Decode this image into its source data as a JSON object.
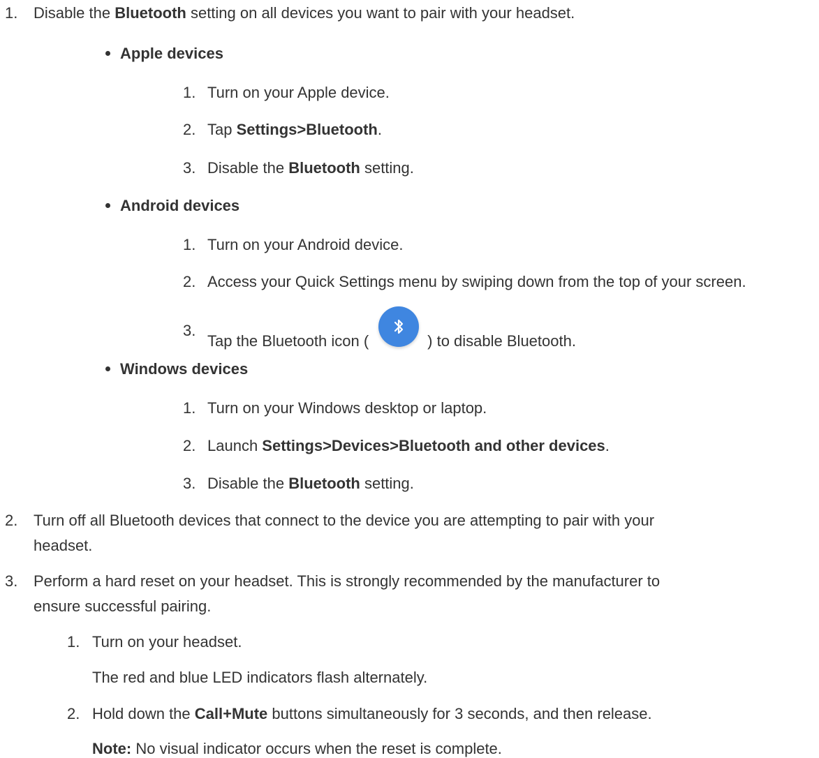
{
  "steps": {
    "s1": {
      "num": "1.",
      "pre": "Disable the ",
      "bold": "Bluetooth",
      "post": " setting on all devices you want to pair with your headset.",
      "groups": {
        "apple": {
          "title": "Apple devices",
          "items": [
            {
              "num": "1.",
              "pre": "Turn on your Apple device.",
              "bold": "",
              "post": ""
            },
            {
              "num": "2.",
              "pre": "Tap ",
              "bold": "Settings>Bluetooth",
              "post": "."
            },
            {
              "num": "3.",
              "pre": "Disable the ",
              "bold": "Bluetooth",
              "post": " setting."
            }
          ]
        },
        "android": {
          "title": "Android devices",
          "items": [
            {
              "num": "1.",
              "pre": "Turn on your Android device.",
              "bold": "",
              "post": ""
            },
            {
              "num": "2.",
              "pre": "Access your Quick Settings menu by swiping down from the top of your screen.",
              "bold": "",
              "post": ""
            },
            {
              "num": "3.",
              "pre": "Tap the Bluetooth icon (",
              "bold": "",
              "post": ") to disable Bluetooth.",
              "icon": "bluetooth-icon"
            }
          ]
        },
        "windows": {
          "title": "Windows devices",
          "items": [
            {
              "num": "1.",
              "pre": "Turn on your Windows desktop or laptop.",
              "bold": "",
              "post": ""
            },
            {
              "num": "2.",
              "pre": "Launch ",
              "bold": "Settings>Devices>Bluetooth and other devices",
              "post": "."
            },
            {
              "num": "3.",
              "pre": "Disable the ",
              "bold": "Bluetooth",
              "post": " setting."
            }
          ]
        }
      }
    },
    "s2": {
      "num": "2.",
      "line1": "Turn off all Bluetooth devices that connect to the device you are attempting to pair with your",
      "line2": "headset."
    },
    "s3": {
      "num": "3.",
      "line1": "Perform a hard reset on your headset. This is strongly recommended by the manufacturer to",
      "line2": "ensure successful pairing.",
      "sub1": {
        "num": "1.",
        "text": "Turn on your headset.",
        "note": "The red and blue LED indicators flash alternately."
      },
      "sub2": {
        "num": "2.",
        "pre": "Hold down the ",
        "bold": "Call+Mute",
        "post": " buttons simultaneously for 3 seconds, and then release.",
        "note_label": "Note:",
        "note_text": " No visual indicator occurs when the reset is complete."
      }
    }
  },
  "colors": {
    "text": "#333333",
    "bluetooth_icon_bg": "#3f86e0"
  }
}
